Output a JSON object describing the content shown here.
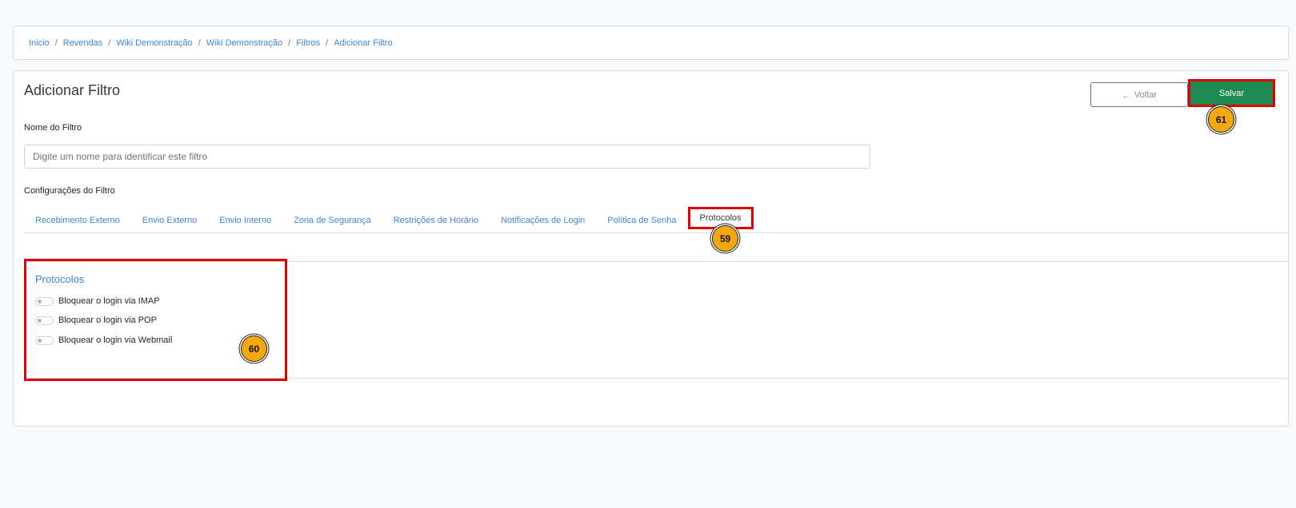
{
  "breadcrumb": [
    "Inicio",
    "Revendas",
    "Wiki Demonstração",
    "Wiki Demonstração",
    "Filtros",
    "Adicionar Filtro"
  ],
  "breadcrumb_separator": "/",
  "page": {
    "title": "Adicionar Filtro",
    "back_label": "Voltar",
    "save_label": "Salvar"
  },
  "form": {
    "name_label": "Nome do Filtro",
    "name_placeholder": "Digite um nome para identificar este filtro",
    "config_label": "Configurações do Filtro"
  },
  "tabs": [
    {
      "label": "Recebimento Externo",
      "active": false
    },
    {
      "label": "Envio Externo",
      "active": false
    },
    {
      "label": "Envio Interno",
      "active": false
    },
    {
      "label": "Zona de Segurança",
      "active": false
    },
    {
      "label": "Restrições de Horário",
      "active": false
    },
    {
      "label": "Notificações de Login",
      "active": false
    },
    {
      "label": "Política de Senha",
      "active": false
    },
    {
      "label": "Protocolos",
      "active": true
    }
  ],
  "panel": {
    "title": "Protocolos",
    "toggles": [
      {
        "label": "Bloquear o login via IMAP",
        "checked": false
      },
      {
        "label": "Bloquear o login via POP",
        "checked": false
      },
      {
        "label": "Bloquear o login via Webmail",
        "checked": false
      }
    ]
  },
  "annotations": {
    "tab_badge": "59",
    "panel_badge": "60",
    "save_badge": "61"
  },
  "colors": {
    "accent_link": "#3d86d9",
    "save_button": "#208a54",
    "highlight": "#e00000",
    "badge": "#f5a80c"
  },
  "icons": {
    "back_arrow": "arrow-left-icon"
  }
}
